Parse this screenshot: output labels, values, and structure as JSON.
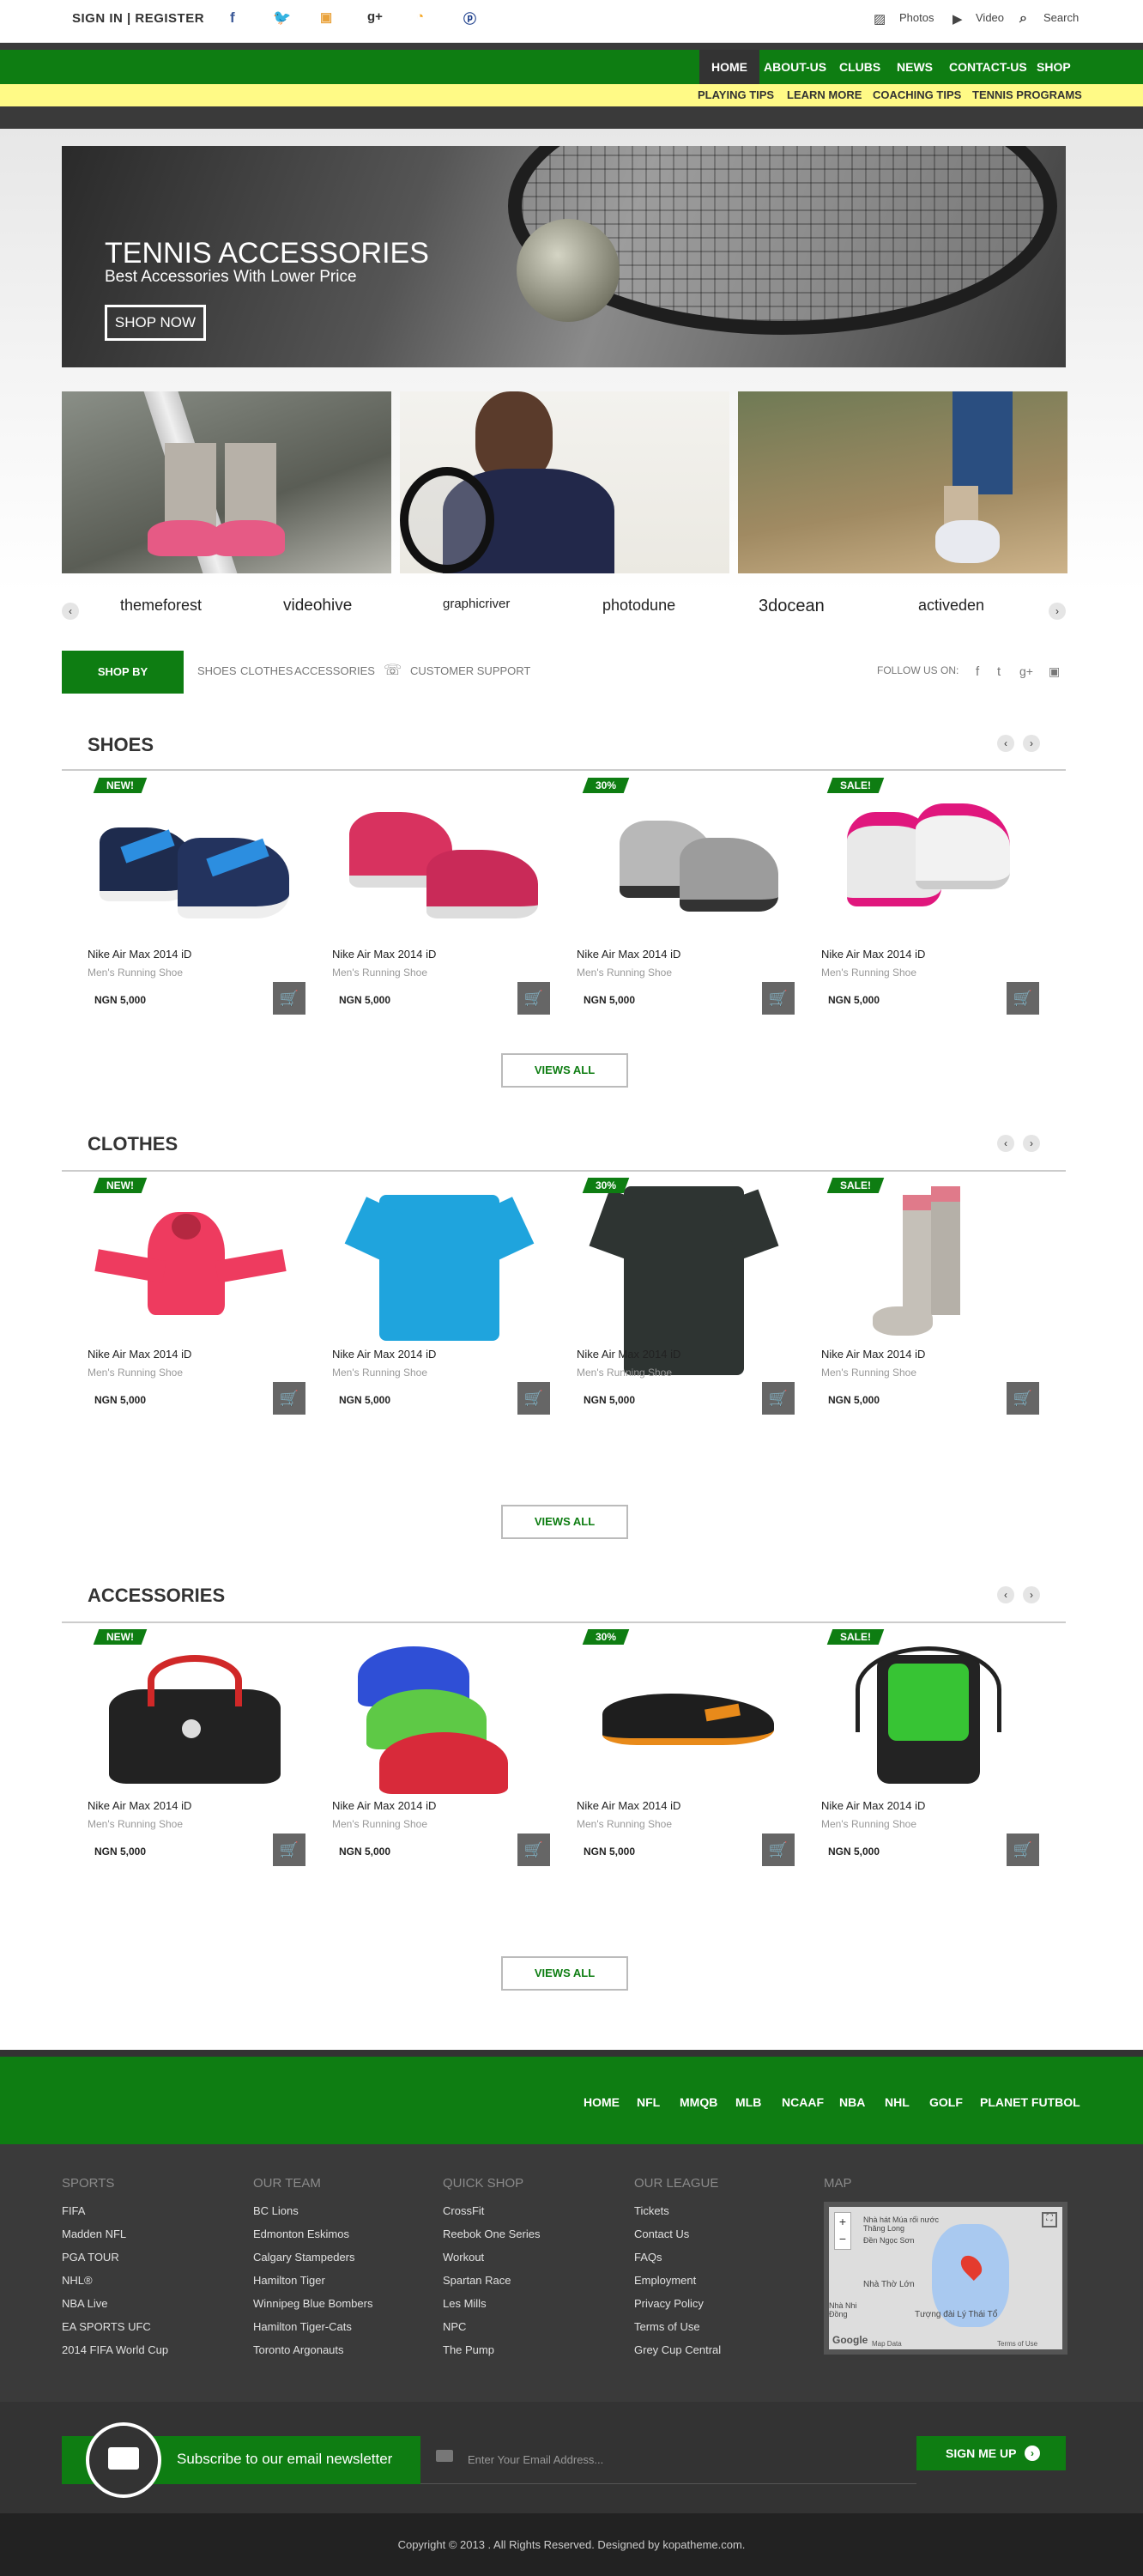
{
  "topbar": {
    "auth_label": "SIGN IN | REGISTER",
    "photos_label": "Photos",
    "video_label": "Video",
    "search_label": "Search"
  },
  "nav": {
    "items": [
      "HOME",
      "ABOUT-US",
      "CLUBS",
      "NEWS",
      "CONTACT-US",
      "SHOP"
    ],
    "subitems": [
      "PLAYING TIPS",
      "LEARN MORE",
      "COACHING TIPS",
      "TENNIS PROGRAMS"
    ]
  },
  "hero": {
    "title": "TENNIS ACCESSORIES",
    "subtitle": "Best Accessories With Lower Price",
    "button": "SHOP NOW"
  },
  "brands": [
    "themeforest",
    "videohive",
    "graphicriver",
    "photodune",
    "3docean",
    "activeden"
  ],
  "categories": {
    "shop_label": "SHOP BY CATEGORIES",
    "links": [
      "SHOES",
      "CLOTHES",
      "ACCESSORIES"
    ],
    "support": "CUSTOMER SUPPORT",
    "follow": "FOLLOW US ON:"
  },
  "sections": [
    {
      "title": "SHOES",
      "view_all": "VIEWS ALL",
      "products": [
        {
          "badge": "NEW!",
          "name": "Nike Air Max 2014 iD",
          "sub": "Men's Running Shoe",
          "price": "NGN 5,000"
        },
        {
          "badge": "",
          "name": "Nike Air Max 2014 iD",
          "sub": "Men's Running Shoe",
          "price": "NGN 5,000"
        },
        {
          "badge": "30%",
          "name": "Nike Air Max 2014 iD",
          "sub": "Men's Running Shoe",
          "price": "NGN 5,000"
        },
        {
          "badge": "SALE!",
          "name": "Nike Air Max 2014 iD",
          "sub": "Men's Running Shoe",
          "price": "NGN 5,000"
        }
      ]
    },
    {
      "title": "CLOTHES",
      "view_all": "VIEWS ALL",
      "products": [
        {
          "badge": "NEW!",
          "name": "Nike Air Max 2014 iD",
          "sub": "Men's Running Shoe",
          "price": "NGN 5,000"
        },
        {
          "badge": "",
          "name": "Nike Air Max 2014 iD",
          "sub": "Men's Running Shoe",
          "price": "NGN 5,000"
        },
        {
          "badge": "30%",
          "name": "Nike Air Max 2014 iD",
          "sub": "Men's Running Shoe",
          "price": "NGN 5,000"
        },
        {
          "badge": "SALE!",
          "name": "Nike Air Max 2014 iD",
          "sub": "Men's Running Shoe",
          "price": "NGN 5,000"
        }
      ]
    },
    {
      "title": "ACCESSORIES",
      "view_all": "VIEWS ALL",
      "products": [
        {
          "badge": "NEW!",
          "name": "Nike Air Max 2014 iD",
          "sub": "Men's Running Shoe",
          "price": "NGN 5,000"
        },
        {
          "badge": "",
          "name": "Nike Air Max 2014 iD",
          "sub": "Men's Running Shoe",
          "price": "NGN 5,000"
        },
        {
          "badge": "30%",
          "name": "Nike Air Max 2014 iD",
          "sub": "Men's Running Shoe",
          "price": "NGN 5,000"
        },
        {
          "badge": "SALE!",
          "name": "Nike Air Max 2014 iD",
          "sub": "Men's Running Shoe",
          "price": "NGN 5,000"
        }
      ]
    }
  ],
  "footer_nav": [
    "HOME",
    "NFL",
    "MMQB",
    "MLB",
    "NCAAF",
    "NBA",
    "NHL",
    "GOLF",
    "PLANET FUTBOL"
  ],
  "footer_cols": [
    {
      "title": "SPORTS",
      "links": [
        "FIFA",
        "Madden NFL",
        "PGA TOUR",
        "NHL®",
        "NBA Live",
        "EA SPORTS UFC",
        "2014 FIFA World Cup"
      ]
    },
    {
      "title": "OUR TEAM",
      "links": [
        "BC Lions",
        "Edmonton Eskimos",
        "Calgary Stampeders",
        "Hamilton Tiger",
        "Winnipeg Blue Bombers",
        "Hamilton Tiger-Cats",
        "Toronto Argonauts"
      ]
    },
    {
      "title": "QUICK SHOP",
      "links": [
        "CrossFit",
        "Reebok One Series",
        "Workout",
        "Spartan Race",
        "Les Mills",
        "NPC",
        "The Pump"
      ]
    },
    {
      "title": "OUR LEAGUE",
      "links": [
        "Tickets",
        "Contact Us",
        "FAQs",
        "Employment",
        "Privacy Policy",
        "Terms of Use",
        "Grey Cup Central"
      ]
    }
  ],
  "map": {
    "title": "MAP",
    "labels": [
      "Nhà hát Múa rối nước Thăng Long",
      "Đền Ngọc Sơn",
      "Nhà Thờ Lớn",
      "Tượng đài Lý Thái Tổ",
      "Nhà Nhi Đồng",
      "Map Data",
      "Terms of Use",
      "Google"
    ]
  },
  "newsletter": {
    "label": "Subscribe to our email newsletter",
    "placeholder": "Enter Your Email Address...",
    "button": "SIGN ME UP"
  },
  "copyright": "Copyright © 2013 . All Rights Reserved. Designed by kopatheme.com.",
  "colors": {
    "green": "#0e7d12",
    "yellow": "#fffa86",
    "dark": "#3a3a3a"
  }
}
